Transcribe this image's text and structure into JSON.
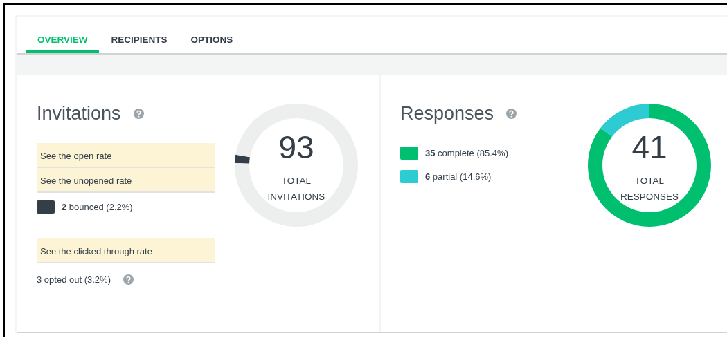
{
  "tabs": [
    {
      "label": "OVERVIEW",
      "selected": true
    },
    {
      "label": "RECIPIENTS",
      "selected": false
    },
    {
      "label": "OPTIONS",
      "selected": false
    }
  ],
  "invitations": {
    "title": "Invitations",
    "items": [
      {
        "kind": "link",
        "text": "See the open rate"
      },
      {
        "kind": "link",
        "text": "See the unopened rate"
      },
      {
        "kind": "legend",
        "text": "**2** bounced (2.2%)",
        "color": "#333e48"
      },
      {
        "kind": "link",
        "text": "See the clicked through rate"
      },
      {
        "kind": "note",
        "text": "3 opted out (3.2%)"
      }
    ],
    "total": "93",
    "total_label": "TOTAL INVITATIONS",
    "chart_data": {
      "type": "donut",
      "values": [
        2.2,
        97.8
      ]
    }
  },
  "responses": {
    "title": "Responses",
    "items": [
      {
        "kind": "legend",
        "text": "**35** complete (85.4%)",
        "color": "#00bf6f"
      },
      {
        "kind": "legend",
        "text": "**6** partial (14.6%)",
        "color": "#2dccd3"
      }
    ],
    "total": "41",
    "total_label": "TOTAL RESPONSES",
    "chart_data": {
      "type": "donut",
      "values": [
        85.4,
        14.6
      ]
    }
  }
}
